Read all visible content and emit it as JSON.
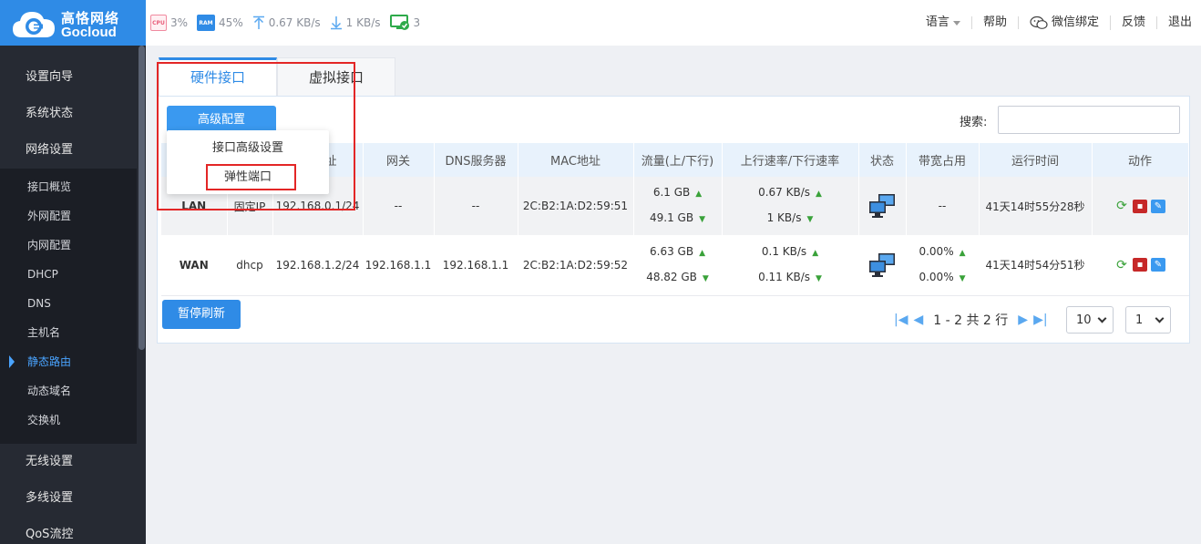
{
  "logo": {
    "cn": "高恪网络",
    "en": "Gocloud"
  },
  "stats": {
    "cpu_label": "CPU",
    "cpu": "3%",
    "ram_label": "RAM",
    "ram": "45%",
    "up": "0.67 KB/s",
    "down": "1 KB/s",
    "clients": "3"
  },
  "topnav": {
    "language": "语言",
    "help": "帮助",
    "wechat": "微信绑定",
    "feedback": "反馈",
    "logout": "退出"
  },
  "sidebar": {
    "main_top": [
      "设置向导",
      "系统状态",
      "网络设置"
    ],
    "sub": [
      "接口概览",
      "外网配置",
      "内网配置",
      "DHCP",
      "DNS",
      "主机名",
      "静态路由",
      "动态域名",
      "交换机"
    ],
    "active_sub": "静态路由",
    "main_bottom": [
      "无线设置",
      "多线设置",
      "QoS流控"
    ]
  },
  "tabs": [
    "硬件接口",
    "虚拟接口"
  ],
  "buttons": {
    "advanced": "高级配置",
    "pause": "暂停刷新"
  },
  "dropdown": [
    "接口高级设置",
    "弹性端口"
  ],
  "search": {
    "label": "搜索:",
    "value": ""
  },
  "table": {
    "headers": [
      "",
      "",
      "地址",
      "网关",
      "DNS服务器",
      "MAC地址",
      "流量(上/下行)",
      "上行速率/下行速率",
      "状态",
      "带宽占用",
      "运行时间",
      "动作"
    ],
    "rows": [
      {
        "name": "LAN",
        "type": "固定IP",
        "ip": "192.168.0.1/24",
        "gw": "--",
        "dns": "--",
        "mac": "2C:B2:1A:D2:59:51",
        "traffic_up": "6.1 GB",
        "traffic_down": "49.1 GB",
        "rate_up": "0.67 KB/s",
        "rate_down": "1 KB/s",
        "bw_up": "--",
        "bw_down": "",
        "uptime": "41天14时55分28秒"
      },
      {
        "name": "WAN",
        "type": "dhcp",
        "ip": "192.168.1.2/24",
        "gw": "192.168.1.1",
        "dns": "192.168.1.1",
        "mac": "2C:B2:1A:D2:59:52",
        "traffic_up": "6.63 GB",
        "traffic_down": "48.82 GB",
        "rate_up": "0.1 KB/s",
        "rate_down": "0.11 KB/s",
        "bw_up": "0.00%",
        "bw_down": "0.00%",
        "uptime": "41天14时54分51秒"
      }
    ]
  },
  "pager": {
    "info": "1 - 2 共 2 行",
    "page_size": "10",
    "page": "1"
  },
  "colors": {
    "accent": "#2f8be6",
    "sidebar": "#262a33",
    "annotation": "#e32626"
  }
}
